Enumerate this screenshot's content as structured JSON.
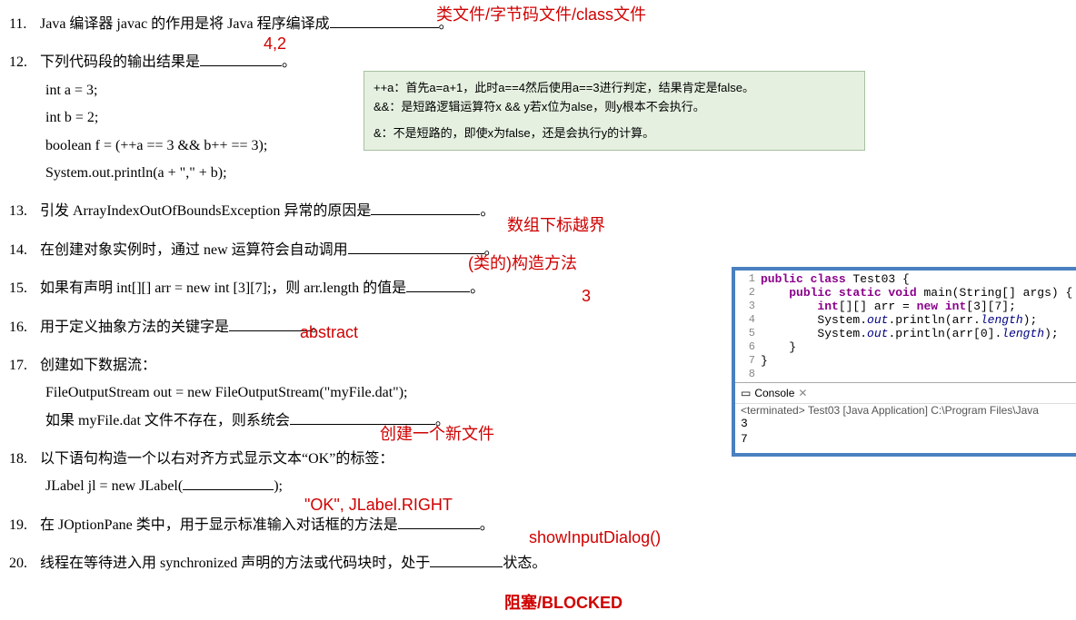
{
  "q11": {
    "num": "11.",
    "text_a": "Java 编译器 javac 的作用是将 Java 程序编译成",
    "text_b": "。"
  },
  "ann11": "类文件/字节码文件/class文件",
  "q12": {
    "num": "12.",
    "text_a": "下列代码段的输出结果是",
    "text_b": "。",
    "code1": "int a = 3;",
    "code2": "int b = 2;",
    "code3": "boolean f = (++a == 3 && b++ == 3);",
    "code4": "System.out.println(a + \",\" + b);"
  },
  "ann12": "4,2",
  "note": {
    "l1": "++a：首先a=a+1，此时a==4然后使用a==3进行判定，结果肯定是false。",
    "l2": "&&：是短路逻辑运算符x && y若x位为alse，则y根本不会执行。",
    "l3": "&：不是短路的，即使x为false，还是会执行y的计算。"
  },
  "q13": {
    "num": "13.",
    "text_a": "引发 ArrayIndexOutOfBoundsException 异常的原因是",
    "text_b": "。"
  },
  "ann13": "数组下标越界",
  "q14": {
    "num": "14.",
    "text_a": "在创建对象实例时，通过 new 运算符会自动调用",
    "text_b": "。"
  },
  "ann14": "(类的)构造方法",
  "q15": {
    "num": "15.",
    "text_a": "如果有声明 int[][] arr = new int [3][7];，则 arr.length 的值是",
    "text_b": "。"
  },
  "ann15": "3",
  "q16": {
    "num": "16.",
    "text_a": "用于定义抽象方法的关键字是",
    "text_b": "。"
  },
  "ann16": "abstract",
  "q17": {
    "num": "17.",
    "text_a": "创建如下数据流：",
    "code1": "FileOutputStream out = new FileOutputStream(\"myFile.dat\");",
    "text_b": "如果 myFile.dat 文件不存在，则系统会",
    "text_c": "。"
  },
  "ann17": "创建一个新文件",
  "q18": {
    "num": "18.",
    "text_a": "以下语句构造一个以右对齐方式显示文本“OK”的标签：",
    "code1": "JLabel jl = new JLabel(",
    "code2": ");"
  },
  "ann18": "\"OK\", JLabel.RIGHT",
  "q19": {
    "num": "19.",
    "text_a": "在 JOptionPane 类中，用于显示标准输入对话框的方法是",
    "text_b": "。"
  },
  "ann19": "showInputDialog()",
  "q20": {
    "num": "20.",
    "text_a": "线程在等待进入用 synchronized 声明的方法或代码块时，处于",
    "text_b": "状态。"
  },
  "ann20": "阻塞/BLOCKED",
  "ide": {
    "l1a": "public class",
    "l1b": " Test03 {",
    "l2a": "public static void",
    "l2b": " main(String[] args) {",
    "l3a": "int",
    "l3b": "[][] arr = ",
    "l3c": "new int",
    "l3d": "[3][7];",
    "l4a": "System.",
    "l4b": "out",
    "l4c": ".println(arr.",
    "l4d": "length",
    "l4e": ");",
    "l5a": "System.",
    "l5b": "out",
    "l5c": ".println(arr[0].",
    "l5d": "length",
    "l5e": ");",
    "l6": "}",
    "l7": "}",
    "l8": ""
  },
  "console": {
    "title": "Console",
    "status": "<terminated> Test03 [Java Application] C:\\Program Files\\Java",
    "out1": "3",
    "out2": "7"
  }
}
